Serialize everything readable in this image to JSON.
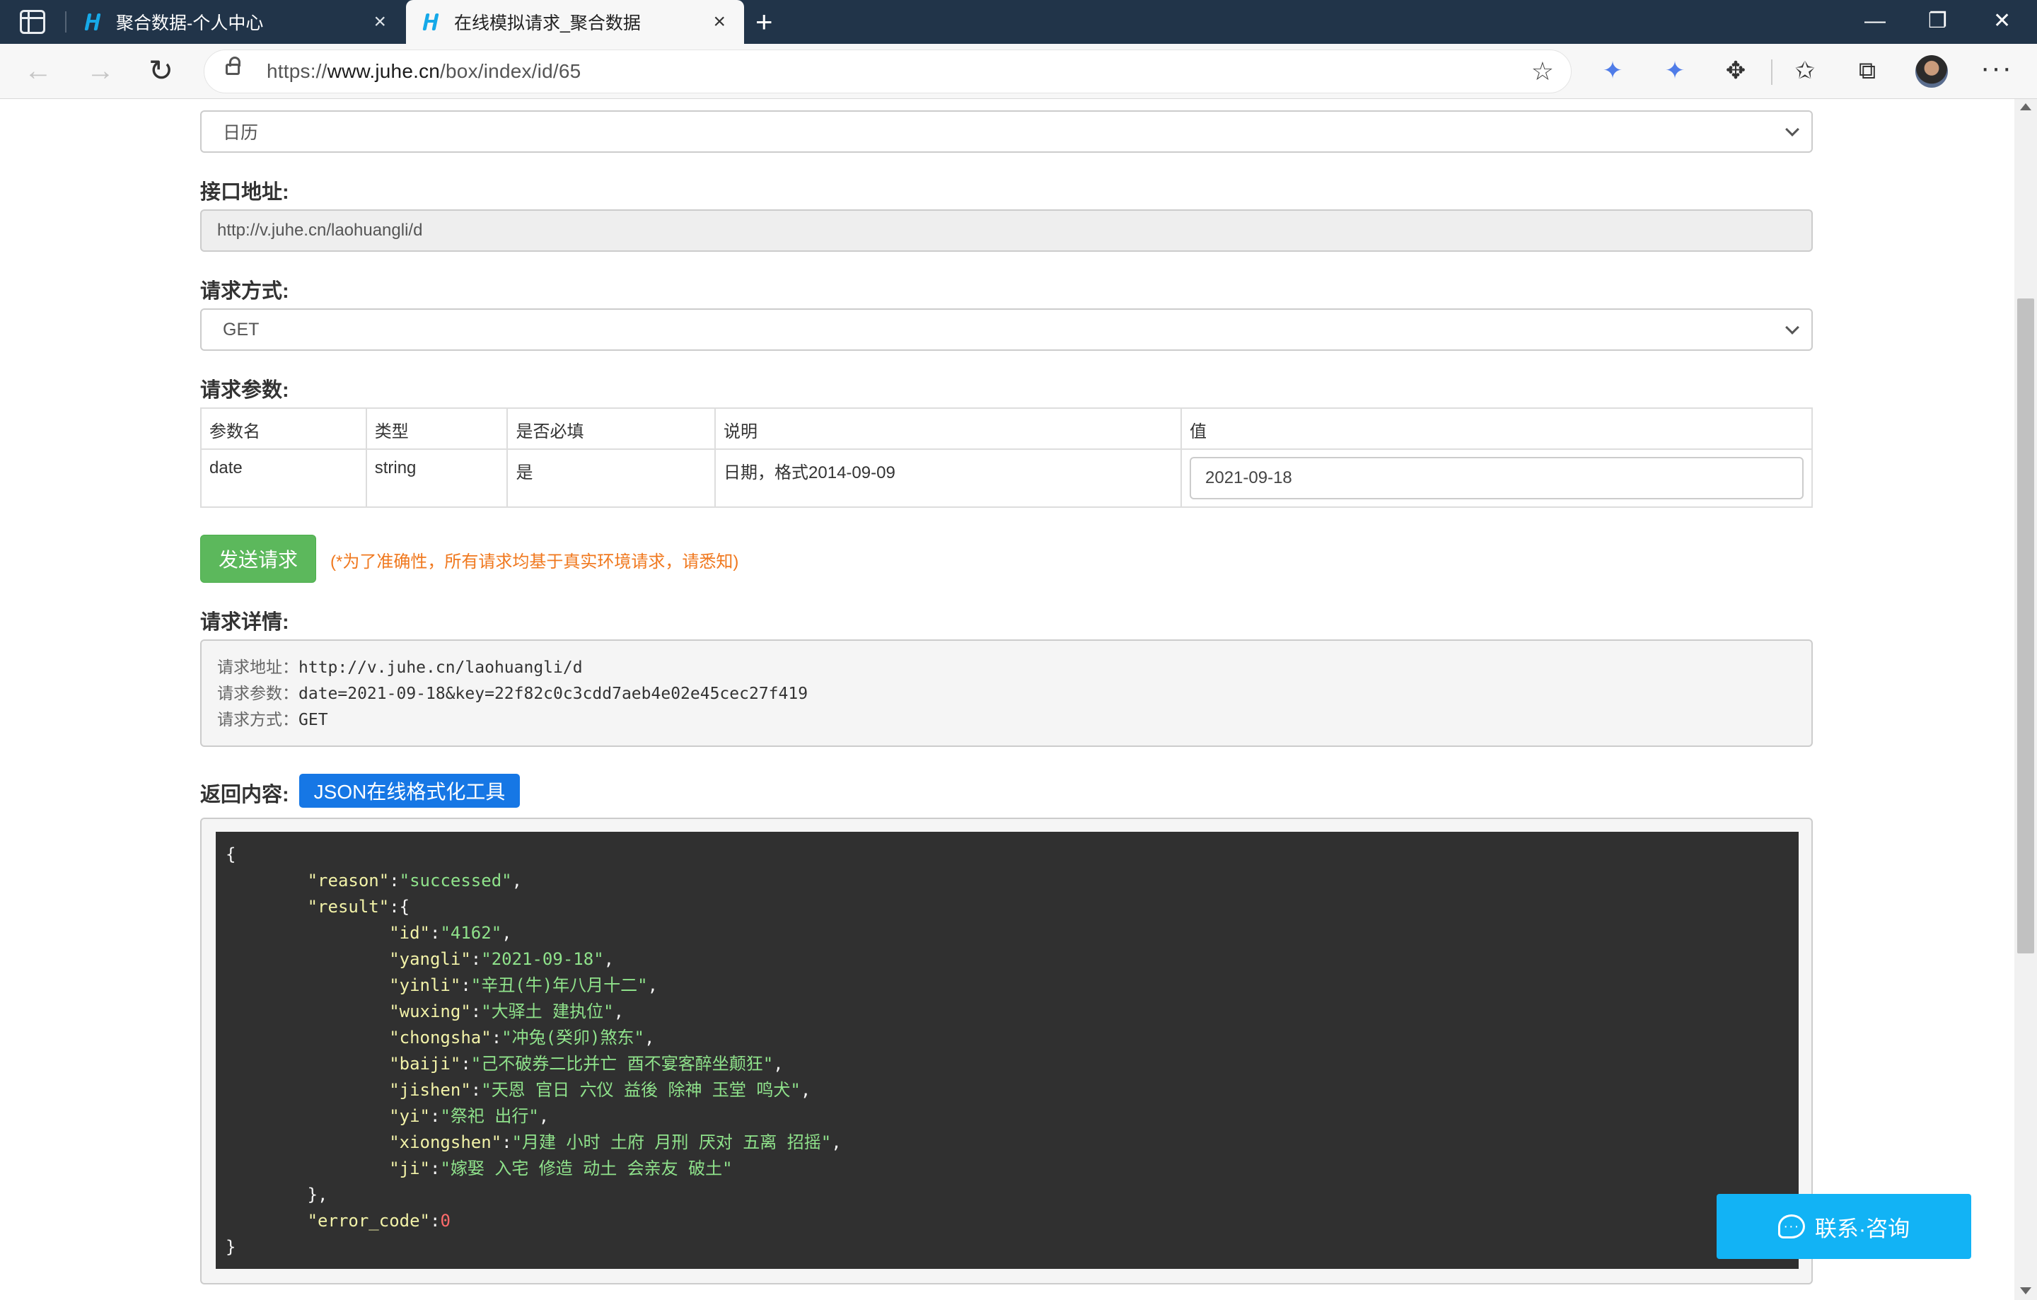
{
  "browser": {
    "tabs": [
      {
        "title": "聚合数据-个人中心",
        "active": false
      },
      {
        "title": "在线模拟请求_聚合数据",
        "active": true
      }
    ],
    "url_prefix": "https://",
    "url_domain": "www.juhe.cn",
    "url_path": "/box/index/id/65"
  },
  "form": {
    "category_select": "日历",
    "endpoint_label": "接口地址:",
    "endpoint_value": "http://v.juhe.cn/laohuangli/d",
    "method_label": "请求方式:",
    "method_select": "GET",
    "params_label": "请求参数:",
    "params_table": {
      "headers": [
        "参数名",
        "类型",
        "是否必填",
        "说明",
        "值"
      ],
      "rows": [
        {
          "name": "date",
          "type": "string",
          "required": "是",
          "desc": "日期，格式2014-09-09",
          "value": "2021-09-18"
        }
      ]
    },
    "send_button": "发送请求",
    "notice": "(*为了准确性，所有请求均基于真实环境请求，请悉知)"
  },
  "details": {
    "label": "请求详情:",
    "address_key": "请求地址：",
    "address_value": "http://v.juhe.cn/laohuangli/d",
    "params_key": "请求参数：",
    "params_value": "date=2021-09-18&key=22f82c0c3cdd7aeb4e02e45cec27f419",
    "method_key": "请求方式：",
    "method_value": "GET"
  },
  "response": {
    "label": "返回内容:",
    "json_tool_button": "JSON在线格式化工具",
    "reason": "successed",
    "result": {
      "id": "4162",
      "yangli": "2021-09-18",
      "yinli": "辛丑(牛)年八月十二",
      "wuxing": "大驿土 建执位",
      "chongsha": "冲兔(癸卯)煞东",
      "baiji": "己不破券二比并亡 酉不宴客醉坐颠狂",
      "jishen": "天恩 官日 六仪 益後 除神 玉堂 鸣犬",
      "yi": "祭祀 出行",
      "xiongshen": "月建 小时 土府 月刑 厌对 五离 招摇",
      "ji": "嫁娶 入宅 修造 动土 会亲友 破土"
    },
    "error_code": "0"
  },
  "contact_button": "联系·咨询",
  "colors": {
    "titlebar": "#213449",
    "send_button": "#5cb85c",
    "notice": "#f0781e",
    "json_button": "#1677e5",
    "contact_button": "#12b3f5",
    "code_bg": "#303030"
  }
}
